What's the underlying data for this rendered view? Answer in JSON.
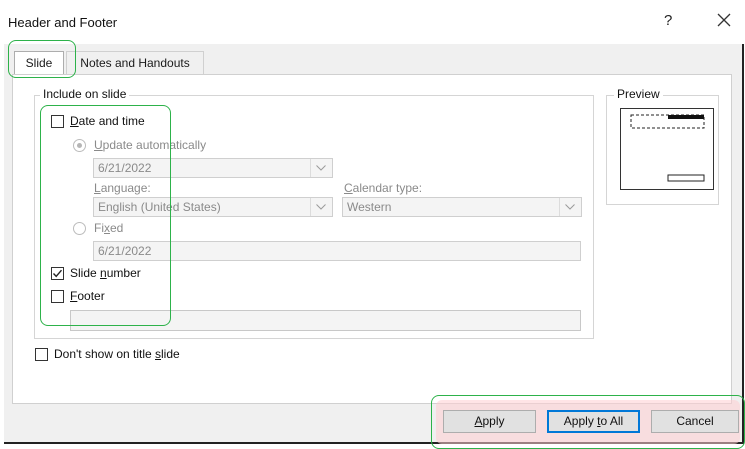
{
  "window": {
    "title": "Header and Footer",
    "help_label": "?"
  },
  "tabs": [
    {
      "label": "Slide",
      "active": true
    },
    {
      "label": "Notes and Handouts",
      "active": false
    }
  ],
  "include_group": {
    "label": "Include on slide",
    "date_time": {
      "label_prefix": "",
      "label_u": "D",
      "label_rest": "ate and time",
      "checked": false
    },
    "update_auto": {
      "label_u": "U",
      "label_rest": "pdate automatically",
      "selected": true,
      "enabled": false
    },
    "date_value": "6/21/2022",
    "language": {
      "label_u": "L",
      "label_rest": "anguage:",
      "value": "English (United States)"
    },
    "calendar": {
      "label_u": "C",
      "label_rest": "alendar type:",
      "value": "Western"
    },
    "fixed": {
      "label_pre": "Fi",
      "label_u": "x",
      "label_rest": "ed",
      "selected": false,
      "value": "6/21/2022"
    },
    "slide_number": {
      "label_pre": "Slide ",
      "label_u": "n",
      "label_rest": "umber",
      "checked": true
    },
    "footer": {
      "label_u": "F",
      "label_rest": "ooter",
      "checked": false,
      "value": ""
    }
  },
  "dont_show": {
    "label_pre": "Don't show on title ",
    "label_u": "s",
    "label_rest": "lide",
    "checked": false
  },
  "preview": {
    "label": "Preview"
  },
  "buttons": {
    "apply": {
      "label_u": "A",
      "label_rest": "pply"
    },
    "apply_all": {
      "label_pre": "Apply ",
      "label_u": "t",
      "label_rest": "o All"
    },
    "cancel": "Cancel"
  },
  "colors": {
    "highlight_green": "#2db24a",
    "highlight_red": "#ffcdd2",
    "accent": "#0078d7"
  }
}
